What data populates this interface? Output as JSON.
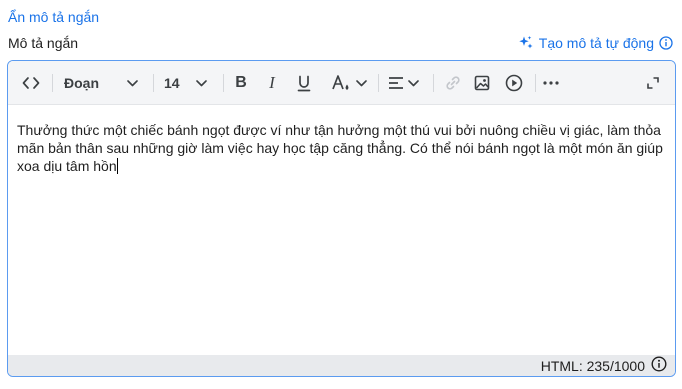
{
  "header": {
    "hide_link": "Ẩn mô tả ngắn",
    "field_label": "Mô tả ngắn",
    "auto_generate": "Tạo mô tả tự động"
  },
  "toolbar": {
    "block_format": "Đoạn",
    "font_size": "14",
    "icons": [
      "code-view-icon",
      "bold-icon",
      "italic-icon",
      "underline-icon",
      "text-color-icon",
      "align-icon",
      "link-icon",
      "image-icon",
      "video-icon",
      "more-icon",
      "fullscreen-icon"
    ]
  },
  "content": {
    "text": "Thưởng thức một chiếc bánh ngọt được ví như tận hưởng một thú vui bởi nuông chiều vị giác, làm thỏa mãn bản thân sau những giờ làm việc hay học tập căng thẳng. Có thể nói bánh ngọt là một món ăn giúp xoa dịu tâm hồn"
  },
  "status": {
    "html_count": "HTML: 235/1000"
  },
  "colors": {
    "accent": "#1a73e8",
    "editor_border": "#5b9bf0",
    "toolbar_bg": "#f4f5f7",
    "statusbar_bg": "#e8eaed"
  }
}
